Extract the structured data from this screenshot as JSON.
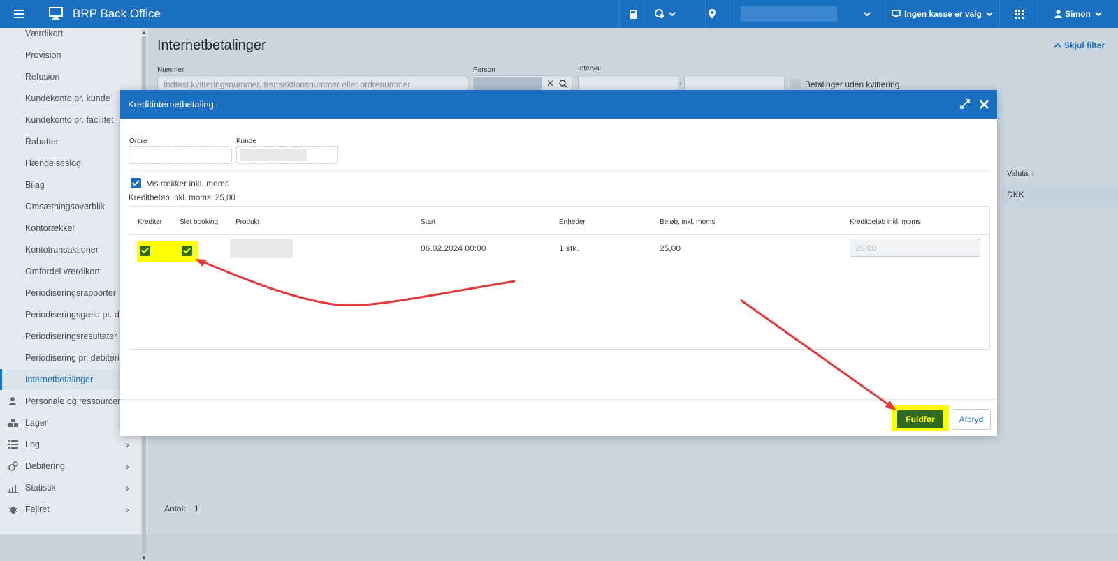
{
  "app": {
    "title": "BRP Back Office"
  },
  "topbar": {
    "cash_register": "Ingen kasse er valg",
    "user": "Simon"
  },
  "sidebar": {
    "items": [
      {
        "label": "Værdikort"
      },
      {
        "label": "Provision"
      },
      {
        "label": "Refusion"
      },
      {
        "label": "Kundekonto pr. kunde"
      },
      {
        "label": "Kundekonto pr. facilitet"
      },
      {
        "label": "Rabatter"
      },
      {
        "label": "Hændelseslog"
      },
      {
        "label": "Bilag"
      },
      {
        "label": "Omsætningsoverblik"
      },
      {
        "label": "Kontorækker"
      },
      {
        "label": "Kontotransaktioner"
      },
      {
        "label": "Omfordel værdikort"
      },
      {
        "label": "Periodiseringsrapporter"
      },
      {
        "label": "Periodiseringsgæld pr. d"
      },
      {
        "label": "Periodiseringsresultater"
      },
      {
        "label": "Periodisering pr. debiteri"
      },
      {
        "label": "Internetbetalinger",
        "active": true
      },
      {
        "label": "Personale og ressourcer"
      },
      {
        "label": "Lager"
      },
      {
        "label": "Log"
      },
      {
        "label": "Debitering"
      },
      {
        "label": "Statistik"
      },
      {
        "label": "Fejlret"
      }
    ]
  },
  "main": {
    "title": "Internetbetalinger",
    "hide_filter": "Skjul filter",
    "filter": {
      "nummer_label": "Nummer",
      "nummer_placeholder": "Indtast kvitteringsnummer, transaktionsnummer eller ordrenummer",
      "person_label": "Person",
      "interval_label": "Interval",
      "interval_sep": "-",
      "no_receipt_label": "Betalinger uden kvittering"
    },
    "table": {
      "valuta_header": "Valuta",
      "valuta_value": "DKK"
    },
    "count_label": "Antal:",
    "count_value": "1"
  },
  "modal": {
    "title": "Kreditinternetbetaling",
    "ordre_label": "Ordre",
    "kunde_label": "Kunde",
    "show_vat_label": "Vis rækker inkl. moms",
    "credit_amount_label": "Kreditbeløb Inkl. moms: 25,00",
    "columns": [
      "Krediter",
      "Slet booking",
      "Produkt",
      "Start",
      "Enheder",
      "Beløb, inkl. moms",
      "Kreditbeløb inkl. moms"
    ],
    "rows": [
      {
        "start": "06.02.2024 00:00",
        "units": "1 stk.",
        "amount": "25,00",
        "credit_amount": "25,00",
        "krediter": true,
        "slet_booking": true
      }
    ],
    "complete_button": "Fuldfør",
    "cancel_button": "Afbryd"
  },
  "colors": {
    "primary": "#1a6fc0",
    "highlight": "#ffff00",
    "confirm": "#2f6b1f",
    "annotation": "#e03a3a"
  }
}
